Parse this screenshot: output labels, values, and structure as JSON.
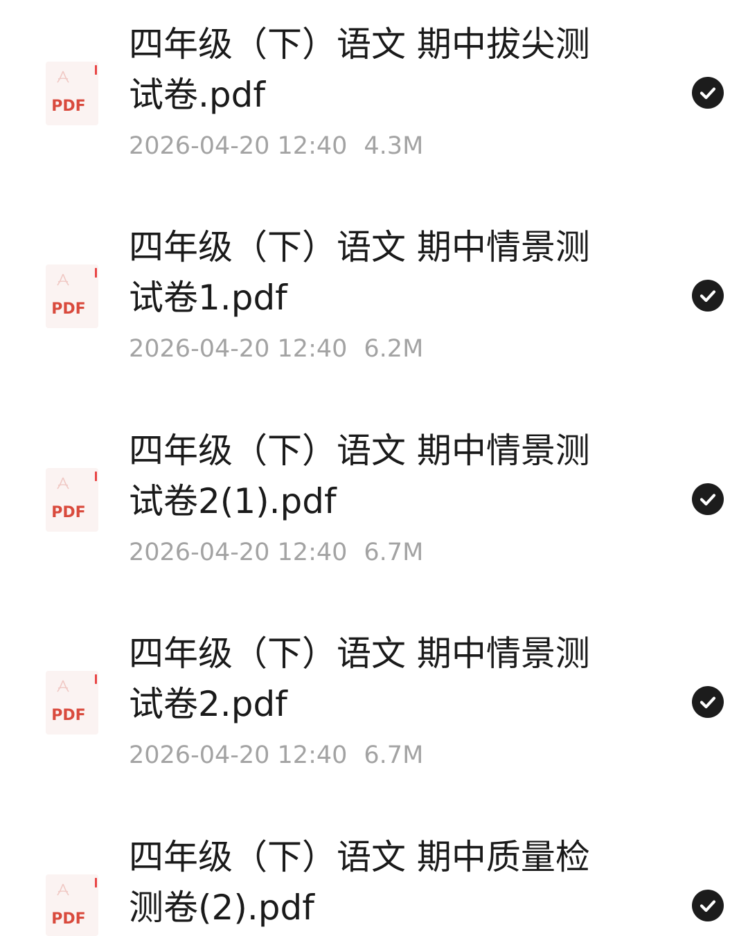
{
  "files": [
    {
      "name": "四年级（下）语文 期中拔尖测试卷.pdf",
      "date": "2026-04-20 12:40",
      "size": "4.3M",
      "type_label": "PDF",
      "icon": "pdf-file-icon",
      "selected_icon": "check-circle-icon"
    },
    {
      "name": "四年级（下）语文 期中情景测试卷1.pdf",
      "date": "2026-04-20 12:40",
      "size": "6.2M",
      "type_label": "PDF",
      "icon": "pdf-file-icon",
      "selected_icon": "check-circle-icon"
    },
    {
      "name": "四年级（下）语文 期中情景测试卷2(1).pdf",
      "date": "2026-04-20 12:40",
      "size": "6.7M",
      "type_label": "PDF",
      "icon": "pdf-file-icon",
      "selected_icon": "check-circle-icon"
    },
    {
      "name": "四年级（下）语文 期中情景测试卷2.pdf",
      "date": "2026-04-20 12:40",
      "size": "6.7M",
      "type_label": "PDF",
      "icon": "pdf-file-icon",
      "selected_icon": "check-circle-icon"
    },
    {
      "name": "四年级（下）语文 期中质量检测卷(2).pdf",
      "date": "",
      "size": "",
      "type_label": "PDF",
      "icon": "pdf-file-icon",
      "selected_icon": "check-circle-icon"
    }
  ],
  "colors": {
    "title_text": "#1a1a1a",
    "meta_text": "#a3a3a3",
    "pdf_red": "#d94a3d",
    "pdf_bg": "#fbf3f2",
    "check_bg": "#1c1c1c"
  }
}
